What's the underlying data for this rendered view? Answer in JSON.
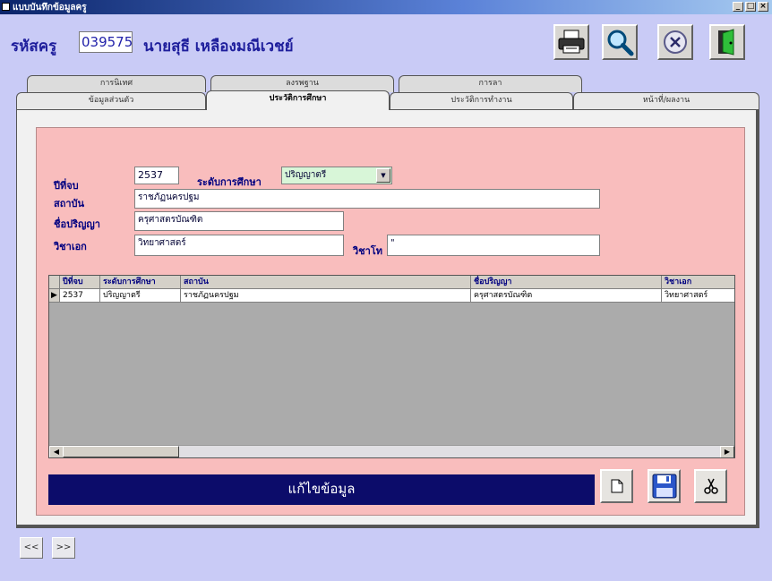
{
  "window": {
    "title": "แบบบันทึกข้อมูลครู",
    "controls": [
      "_",
      "□",
      "×"
    ]
  },
  "header": {
    "id_label": "รหัสครู",
    "id_value": "039575",
    "person_name": "นายสุธี เหลืองมณีเวชย์"
  },
  "toolbar": {
    "print": "printer-icon",
    "search": "search-icon",
    "cancel": "cancel-icon",
    "exit": "exit-door-icon"
  },
  "tabs": {
    "back_row": [
      "การนิเทศ",
      "ลงรพฐาน",
      "การลา"
    ],
    "front_row": [
      "ข้อมูลส่วนตัว",
      "ประวัติการศึกษา",
      "ประวัติการทำงาน",
      "หน้าที่/ผลงาน"
    ],
    "active": "ประวัติการศึกษา"
  },
  "form": {
    "year_label": "ปีที่จบ",
    "year_value": "2537",
    "level_label": "ระดับการศึกษา",
    "level_value": "ปริญญาตรี",
    "institution_label": "สถาบัน",
    "institution_value": "ราชภัฏนครปฐม",
    "degree_label": "ชื่อปริญญา",
    "degree_value": "ครุศาสตรบัณฑิต",
    "major_label": "วิชาเอก",
    "major_value": "วิทยาศาสตร์",
    "minor_label": "วิชาโท",
    "minor_value": "\""
  },
  "grid": {
    "columns": [
      "ปีที่จบ",
      "ระดับการศึกษา",
      "สถาบัน",
      "ชื่อปริญญา",
      "วิชาเอก"
    ],
    "rows": [
      [
        "2537",
        "ปริญญาตรี",
        "ราชภัฏนครปฐม",
        "ครุศาสตรบัณฑิต",
        "วิทยาศาสตร์"
      ]
    ],
    "row_indicator": "▶"
  },
  "actions": {
    "edit_label": "แก้ไขข้อมูล",
    "new": "new-document-icon",
    "save": "save-disk-icon",
    "delete": "scissors-icon"
  },
  "nav": {
    "prev": "<<",
    "next": ">>"
  }
}
